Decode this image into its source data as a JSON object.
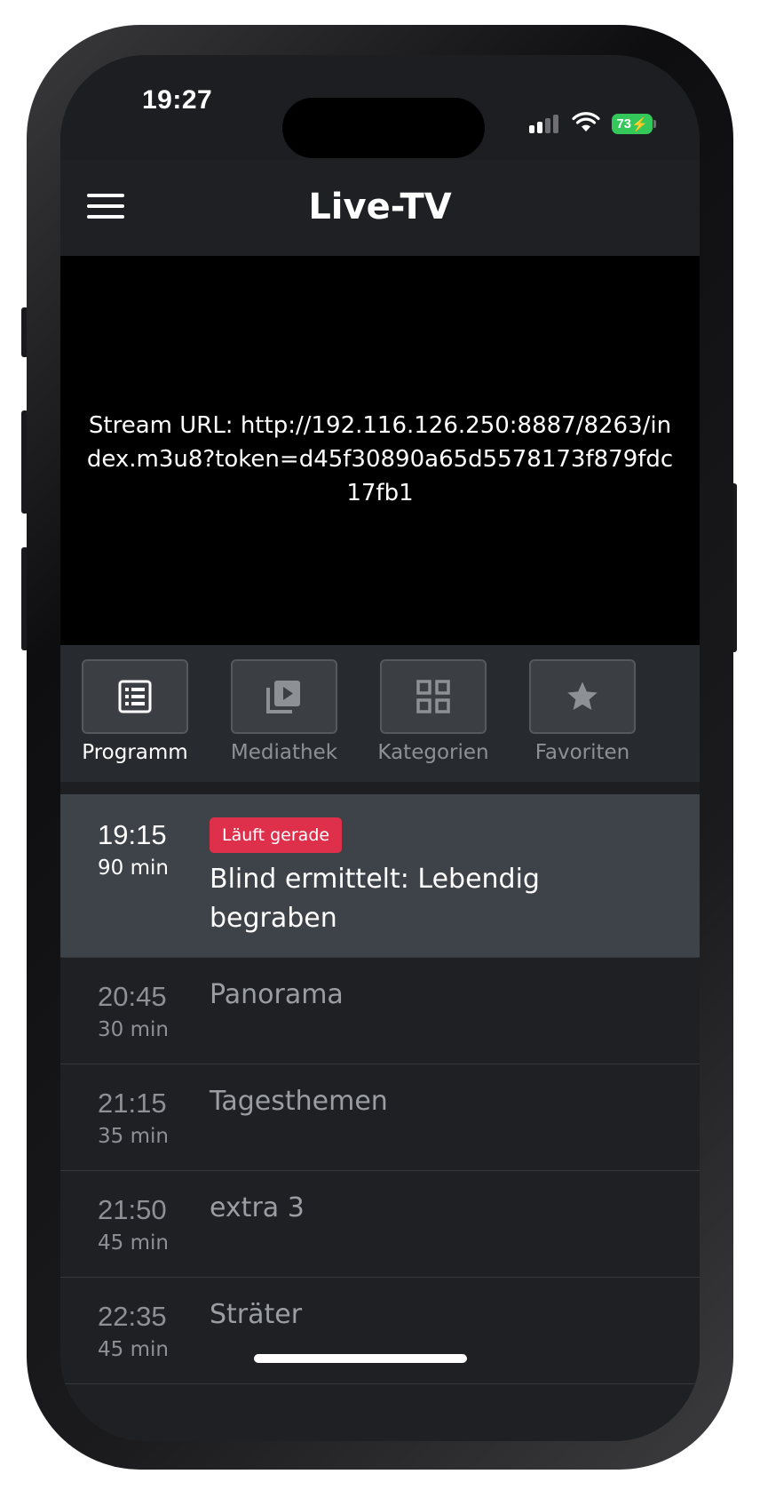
{
  "status_bar": {
    "time": "19:27",
    "battery": "73"
  },
  "header": {
    "title": "Live-TV"
  },
  "player": {
    "stream_url": "Stream URL: http://192.116.126.250:8887/8263/index.m3u8?token=d45f30890a65d5578173f879fdc17fb1"
  },
  "tabs": [
    {
      "label": "Programm",
      "icon": "list-icon",
      "active": true
    },
    {
      "label": "Mediathek",
      "icon": "video-library-icon",
      "active": false
    },
    {
      "label": "Kategorien",
      "icon": "grid-icon",
      "active": false
    },
    {
      "label": "Favoriten",
      "icon": "star-icon",
      "active": false
    }
  ],
  "program": [
    {
      "time": "19:15",
      "duration": "90 min",
      "title": "Blind ermittelt: Lebendig begraben",
      "badge": "Läuft gerade",
      "current": true
    },
    {
      "time": "20:45",
      "duration": "30 min",
      "title": "Panorama"
    },
    {
      "time": "21:15",
      "duration": "35 min",
      "title": "Tagesthemen"
    },
    {
      "time": "21:50",
      "duration": "45 min",
      "title": "extra 3"
    },
    {
      "time": "22:35",
      "duration": "45 min",
      "title": "Sträter"
    }
  ],
  "colors": {
    "background": "#1e2024",
    "live_badge": "#de2f4b",
    "current_row": "#3e4249",
    "battery": "#34c759"
  }
}
